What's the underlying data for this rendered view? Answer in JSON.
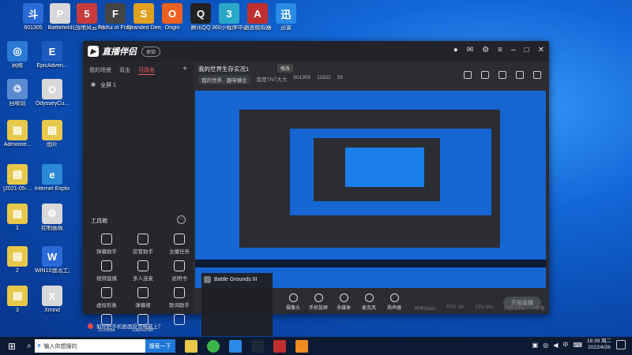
{
  "desktop_icons": [
    {
      "label": "601305",
      "color": "#2a6ad6",
      "glyph": "斗"
    },
    {
      "label": "Battlefield",
      "color": "#d8d8d8",
      "glyph": "P"
    },
    {
      "label": "《战地风云 5》",
      "color": "#c83c3c",
      "glyph": "5"
    },
    {
      "label": "Fistful of Frags",
      "color": "#444",
      "glyph": "F"
    },
    {
      "label": "Stranded Deep",
      "color": "#e0a020",
      "glyph": "S"
    },
    {
      "label": "Origin",
      "color": "#f06020",
      "glyph": "O"
    },
    {
      "label": "腾讯QQ",
      "color": "#222",
      "glyph": "Q"
    },
    {
      "label": "360小程序中心",
      "color": "#2aa8c8",
      "glyph": "3"
    },
    {
      "label": "逍遥模拟器",
      "color": "#c03030",
      "glyph": "A"
    },
    {
      "label": "迅雷",
      "color": "#2a8ae6",
      "glyph": "迅"
    },
    {
      "label": "网络",
      "color": "#2a7ad6",
      "glyph": "◎"
    },
    {
      "label": "EpicAdven...",
      "color": "#1e5abf",
      "glyph": "E"
    },
    {
      "label": "回收站",
      "color": "#5a8ad0",
      "glyph": "♲"
    },
    {
      "label": "OdysseyCu...",
      "color": "#d8d8d8",
      "glyph": "O"
    },
    {
      "label": "Administr...",
      "color": "#e8c84a",
      "glyph": "▤"
    },
    {
      "label": "图片",
      "color": "#e8c84a",
      "glyph": "▤"
    },
    {
      "label": "[2021-05-...",
      "color": "#e8c84a",
      "glyph": "▤"
    },
    {
      "label": "Internet Explorer",
      "color": "#2a8ad8",
      "glyph": "e"
    },
    {
      "label": "1",
      "color": "#e8c84a",
      "glyph": "▤"
    },
    {
      "label": "控制面板",
      "color": "#d8d8d8",
      "glyph": "⚙"
    },
    {
      "label": "2",
      "color": "#e8c84a",
      "glyph": "▤"
    },
    {
      "label": "WIN10激活工具",
      "color": "#2a6ad6",
      "glyph": "W"
    },
    {
      "label": "3",
      "color": "#e8c84a",
      "glyph": "▤"
    },
    {
      "label": "Xmind",
      "color": "#d8d8d8",
      "glyph": "X"
    }
  ],
  "app": {
    "name": "直播伴侣",
    "badge": "体验",
    "left_tabs": [
      "我的场景",
      "双击",
      "可改名"
    ],
    "scene_name": "全屏 1",
    "tools_title": "工具箱",
    "tools": [
      {
        "label": "弹幕助手"
      },
      {
        "label": "房管助手"
      },
      {
        "label": "主播任务"
      },
      {
        "label": "视频直播"
      },
      {
        "label": "多人连麦"
      },
      {
        "label": "说明书"
      },
      {
        "label": "虚拟形象"
      },
      {
        "label": "弹幕姬"
      },
      {
        "label": "歌词助手"
      },
      {
        "label": "Zombie"
      },
      {
        "label": "Launcher"
      },
      {
        "label": ""
      }
    ],
    "tip": "如何把手机画面投到电脑上？",
    "stream_title": "我的世界生存实况1",
    "edit_label": "修改",
    "category": "我的世界 · 趣味横生",
    "streamer": "我是TNT大大",
    "room_id": "601305",
    "viewers": "11932",
    "likes": "58",
    "controls": [
      "摄像头",
      "手机投屏",
      "多媒体",
      "麦克风",
      "扬声器"
    ],
    "live_button": "开始直播",
    "status": [
      "码率0kb/s",
      "FPS: 60",
      "CPU:6%",
      "内存:27%",
      "中等"
    ]
  },
  "popup": {
    "title": "Battle Grounds III"
  },
  "taskbar": {
    "search_placeholder": "输入你想搜的",
    "search_button": "搜索一下",
    "tray_lang": "中",
    "time": "18:39 周二",
    "date": "2022/4/26"
  }
}
